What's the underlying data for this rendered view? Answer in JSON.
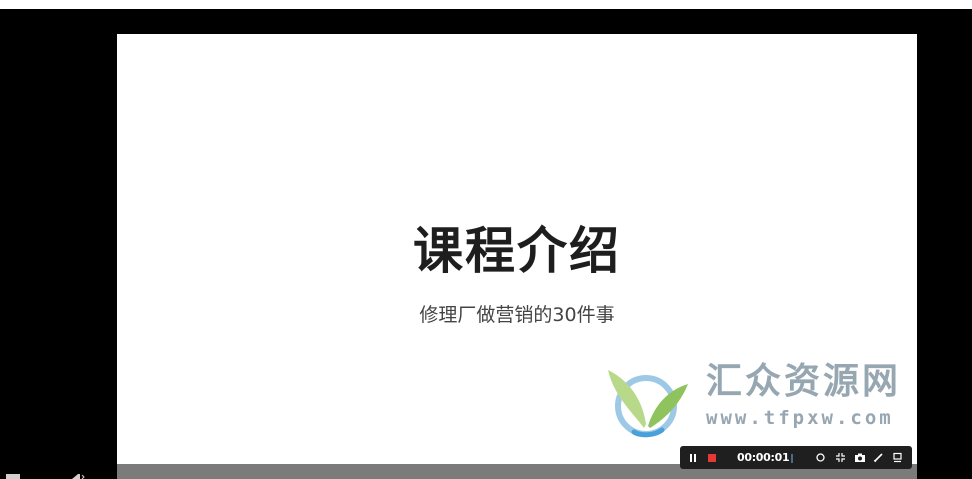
{
  "slide": {
    "title": "课程介绍",
    "subtitle": "修理厂做营销的30件事"
  },
  "watermark": {
    "name": "汇众资源网",
    "url": "www.tfpxw.com"
  },
  "recorder": {
    "elapsed": "00:00:01",
    "pause_icon": "pause-icon",
    "stop_icon": "stop-icon",
    "tools": [
      "zoom-icon",
      "crop-icon",
      "camera-icon",
      "pen-icon",
      "window-icon"
    ]
  },
  "colors": {
    "background": "#000000",
    "slide": "#ffffff",
    "title": "#1e1e1e",
    "stop": "#e53935",
    "watermark": "#97a7b2"
  }
}
